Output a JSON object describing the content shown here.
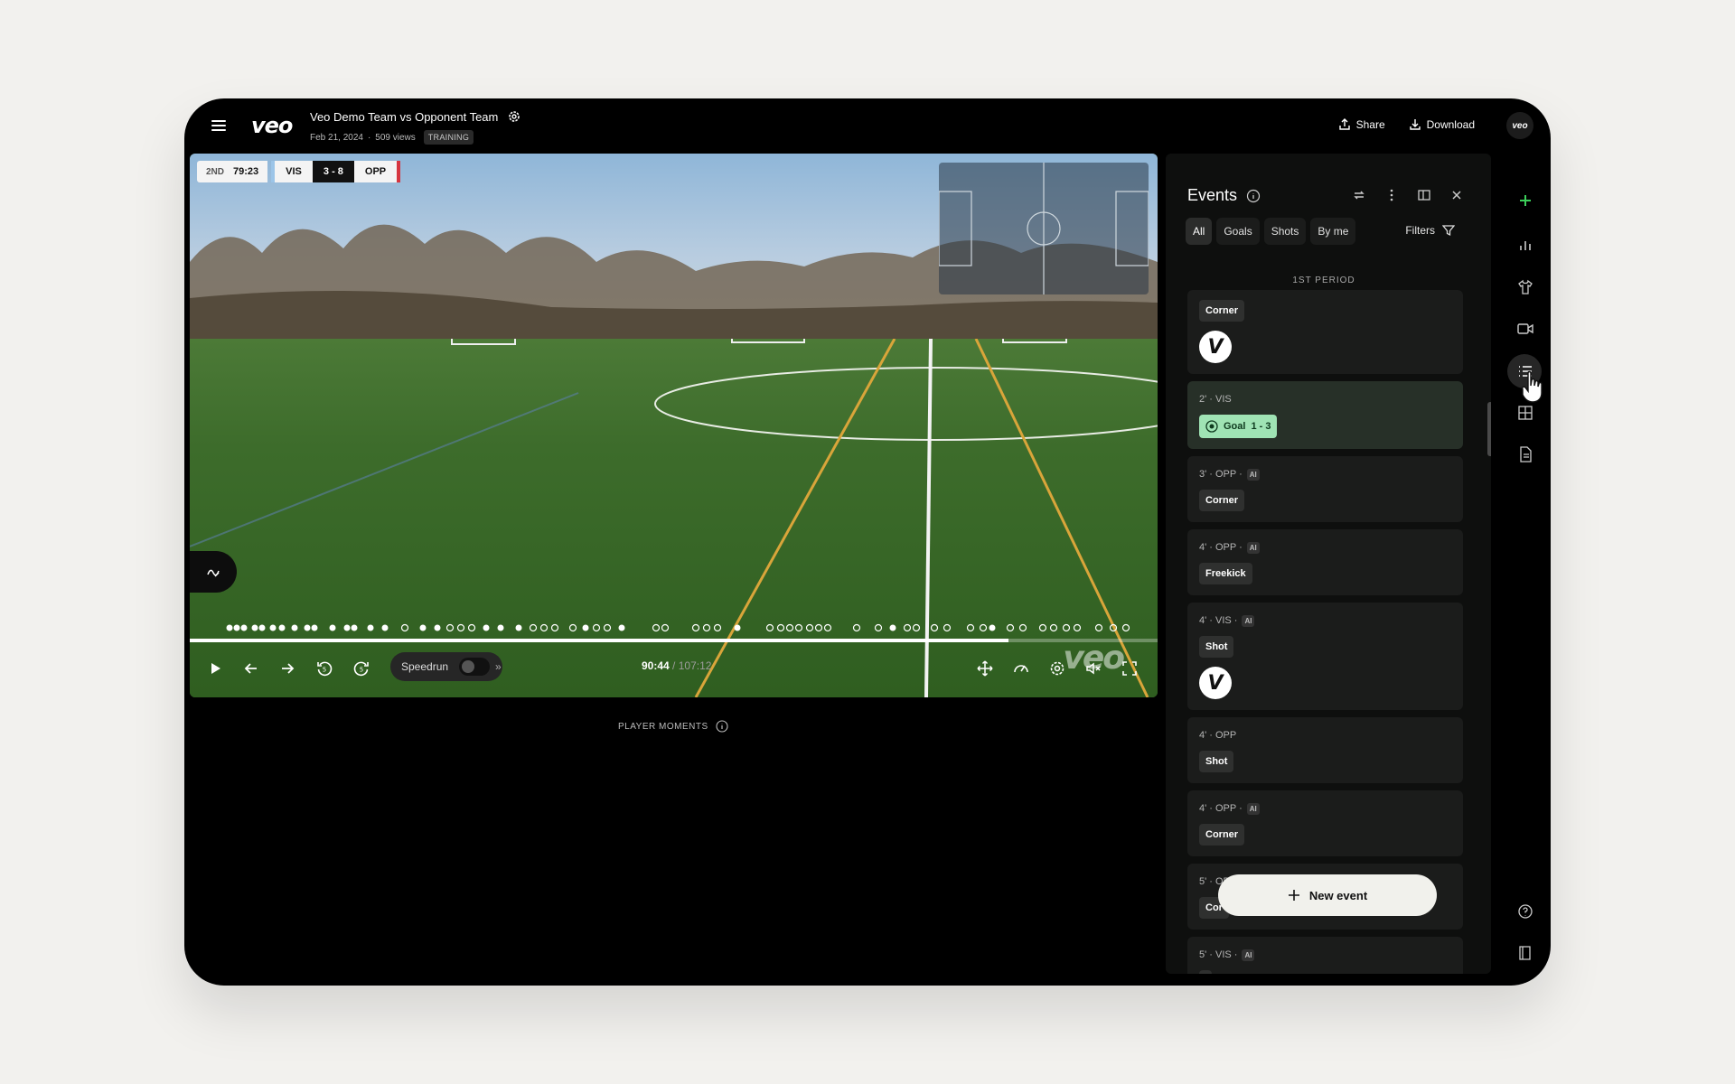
{
  "header": {
    "logo": "veo",
    "title": "Veo Demo Team vs Opponent Team",
    "date": "Feb 21, 2024",
    "views": "509 views",
    "tag": "TRAINING",
    "share_label": "Share",
    "download_label": "Download",
    "avatar_text": "veo"
  },
  "scoreboard": {
    "period": "2ND",
    "clock": "79:23",
    "home": "VIS",
    "score": "3 - 8",
    "away": "OPP",
    "home_color": "#9cc5e8",
    "away_color": "#d6353f"
  },
  "player": {
    "watermark": "veo",
    "speedrun_label": "Speedrun",
    "current_time": "90:44",
    "total_time": "107:12",
    "progress": 0.846
  },
  "player_moments_label": "PLAYER MOMENTS",
  "events_panel": {
    "title": "Events",
    "tabs": [
      "All",
      "Goals",
      "Shots",
      "By me"
    ],
    "active_tab": "All",
    "filters_label": "Filters",
    "period_label": "1ST PERIOD",
    "items": [
      {
        "header": "",
        "chip": "Corner",
        "logo": true
      },
      {
        "header": "2' · VIS",
        "chip": "Goal",
        "score": "1 - 3",
        "goal": true
      },
      {
        "header": "3' · OPP ·",
        "ai": "AI",
        "chip": "Corner"
      },
      {
        "header": "4' · OPP ·",
        "ai": "AI",
        "chip": "Freekick"
      },
      {
        "header": "4' · VIS ·",
        "ai": "AI",
        "chip": "Shot",
        "logo": true
      },
      {
        "header": "4' · OPP",
        "chip": "Shot"
      },
      {
        "header": "4' · OPP ·",
        "ai": "AI",
        "chip": "Corner"
      },
      {
        "header": "5' · OPP",
        "chip": "Cor"
      },
      {
        "header": "5' · VIS ·",
        "ai": "AI",
        "chip": ""
      }
    ],
    "new_event_label": "New event"
  },
  "rail": {
    "icons": [
      "plus-icon",
      "stats-icon",
      "jersey-icon",
      "video-icon",
      "list-icon",
      "layout-icon",
      "document-icon",
      "help-icon",
      "book-icon"
    ],
    "accent": "#3ccf5a"
  }
}
